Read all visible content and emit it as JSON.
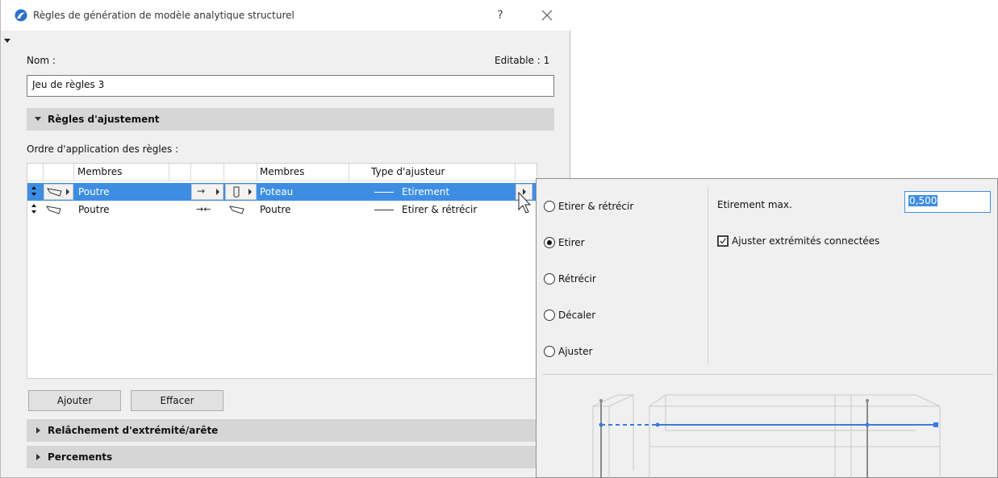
{
  "window": {
    "title": "Règles de génération de modèle analytique structurel",
    "help_label": "?"
  },
  "name_field": {
    "label": "Nom :",
    "value": "Jeu de règles 3",
    "editable_label": "Editable : 1"
  },
  "sections": {
    "adjust": "Règles d'ajustement",
    "release": "Relâchement d'extrémité/arête",
    "openings": "Percements"
  },
  "rules": {
    "order_label": "Ordre d'application des règles :",
    "columns": {
      "members_a": "Membres",
      "members_b": "Membres",
      "adjuster_type": "Type d'ajusteur"
    },
    "rows": [
      {
        "member_a": "Poutre",
        "arrow": "→",
        "member_b": "Poteau",
        "adjuster": "Etirement",
        "selected": true
      },
      {
        "member_a": "Poutre",
        "arrow": "→←",
        "member_b": "Poutre",
        "adjuster": "Etirer & rétrécir",
        "selected": false
      }
    ]
  },
  "buttons": {
    "add": "Ajouter",
    "delete": "Effacer"
  },
  "popup": {
    "options": [
      {
        "label": "Etirer & rétrécir",
        "checked": false
      },
      {
        "label": "Etirer",
        "checked": true
      },
      {
        "label": "Rétrécir",
        "checked": false
      },
      {
        "label": "Décaler",
        "checked": false
      },
      {
        "label": "Ajuster",
        "checked": false
      }
    ],
    "max_stretch_label": "Etirement max.",
    "max_stretch_value": "0,500",
    "adjust_connected_label": "Ajuster extrémités connectées",
    "adjust_connected_checked": true
  },
  "colors": {
    "selection": "#3d8ee3",
    "preview_line": "#3a7be0"
  }
}
